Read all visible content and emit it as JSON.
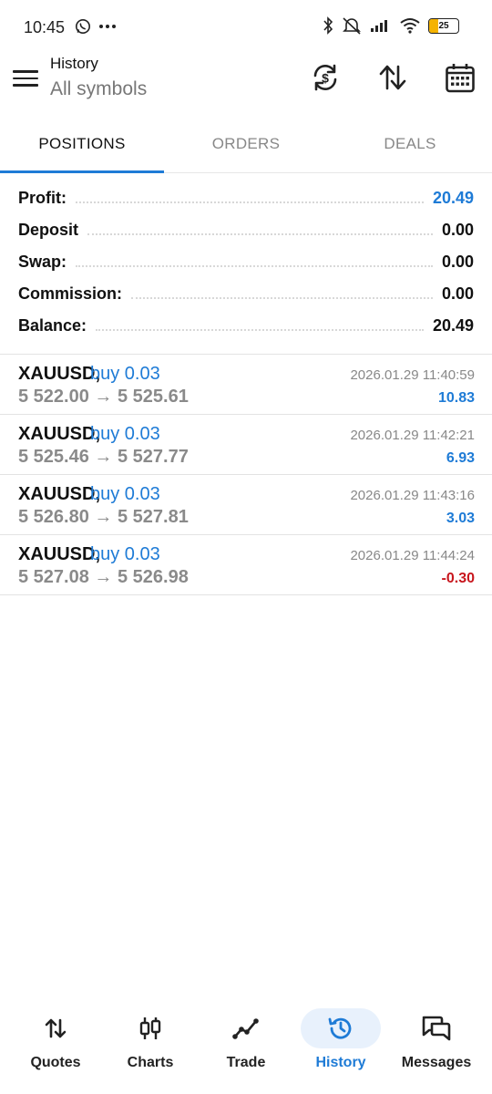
{
  "status_bar": {
    "time": "10:45",
    "battery": "25"
  },
  "header": {
    "title": "History",
    "subtitle": "All symbols",
    "actions": [
      "currency-exchange-icon",
      "sort-icon",
      "calendar-icon"
    ]
  },
  "tabs": [
    {
      "label": "POSITIONS",
      "active": true
    },
    {
      "label": "ORDERS",
      "active": false
    },
    {
      "label": "DEALS",
      "active": false
    }
  ],
  "summary": [
    {
      "label": "Profit:",
      "value": "20.49",
      "color": "#1e7bd6"
    },
    {
      "label": "Deposit",
      "value": "0.00"
    },
    {
      "label": "Swap:",
      "value": "0.00"
    },
    {
      "label": "Commission:",
      "value": "0.00"
    },
    {
      "label": "Balance:",
      "value": "20.49"
    }
  ],
  "deals": [
    {
      "symbol": "XAUUSD,",
      "side": "buy 0.03",
      "prices": "5 522.00 → 5 525.61",
      "time": "2026.01.29 11:40:59",
      "profit": "10.83",
      "negative": false
    },
    {
      "symbol": "XAUUSD,",
      "side": "buy 0.03",
      "prices": "5 525.46 → 5 527.77",
      "time": "2026.01.29 11:42:21",
      "profit": "6.93",
      "negative": false
    },
    {
      "symbol": "XAUUSD,",
      "side": "buy 0.03",
      "prices": "5 526.80 → 5 527.81",
      "time": "2026.01.29 11:43:16",
      "profit": "3.03",
      "negative": false
    },
    {
      "symbol": "XAUUSD,",
      "side": "buy 0.03",
      "prices": "5 527.08 → 5 526.98",
      "time": "2026.01.29 11:44:24",
      "profit": "-0.30",
      "negative": true
    }
  ],
  "bottom_nav": [
    {
      "label": "Quotes",
      "icon": "quotes-arrows-icon",
      "active": false
    },
    {
      "label": "Charts",
      "icon": "candlestick-icon",
      "active": false
    },
    {
      "label": "Trade",
      "icon": "trade-line-icon",
      "active": false
    },
    {
      "label": "History",
      "icon": "history-clock-icon",
      "active": true
    },
    {
      "label": "Messages",
      "icon": "messages-icon",
      "active": false
    }
  ],
  "colors": {
    "accent": "#1e7bd6",
    "negative": "#c8161d",
    "active_nav_bg": "#e8f1fc"
  }
}
